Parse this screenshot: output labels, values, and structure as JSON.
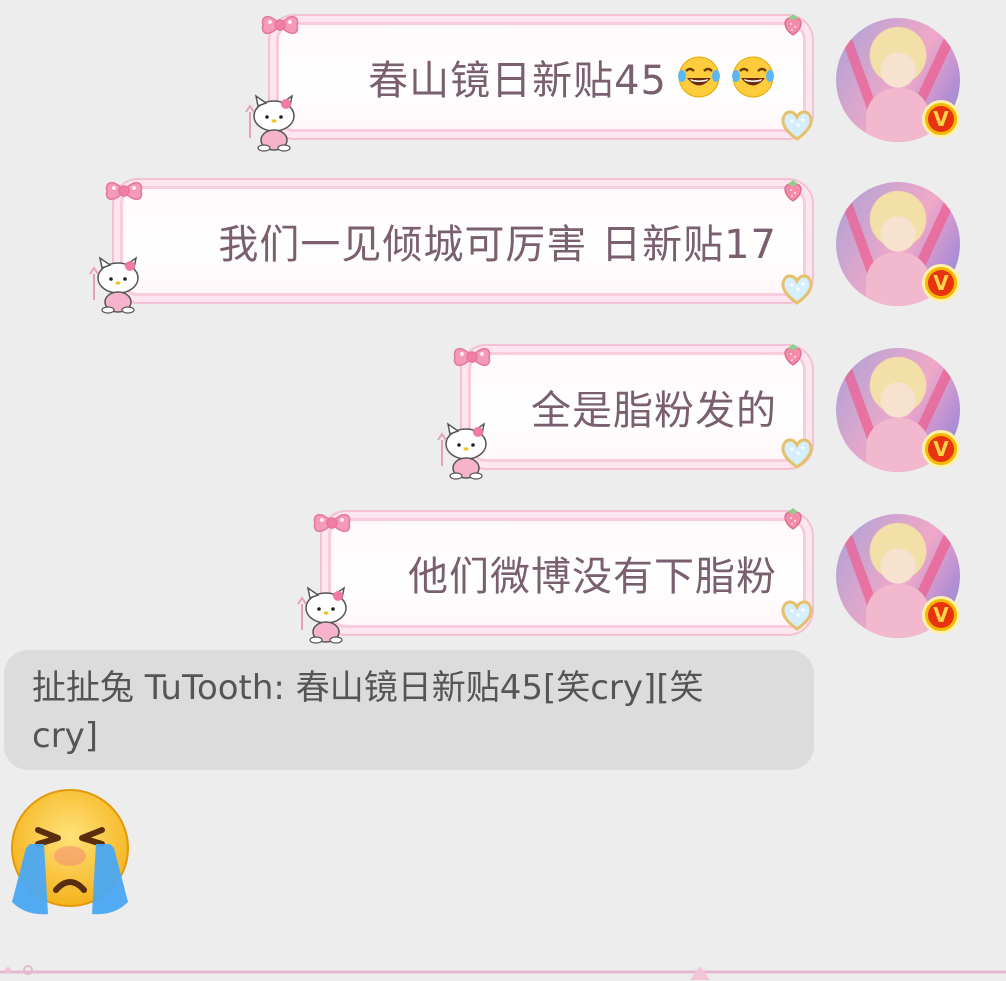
{
  "messages": [
    {
      "text": "春山镜日新贴45",
      "emojis": [
        "tears-of-joy-emoji",
        "tears-of-joy-emoji"
      ]
    },
    {
      "text": "我们一见倾城可厉害 日新贴17"
    },
    {
      "text": "全是脂粉发的"
    },
    {
      "text": "他们微博没有下脂粉"
    }
  ],
  "quote": {
    "text": "扯扯兔 TuTooth: 春山镜日新贴45[笑cry][笑\ncry]"
  },
  "sticker": {
    "icon": "crying-face-sticker"
  },
  "avatar": {
    "badge_label": "V",
    "badge_color": "#e8330e",
    "badge_ring_color": "#f5b800"
  },
  "colors": {
    "background": "#ededed",
    "bubble_border": "#f7cddd",
    "bubble_text": "#7a5f6f",
    "quote_background": "#dcdcdc"
  }
}
